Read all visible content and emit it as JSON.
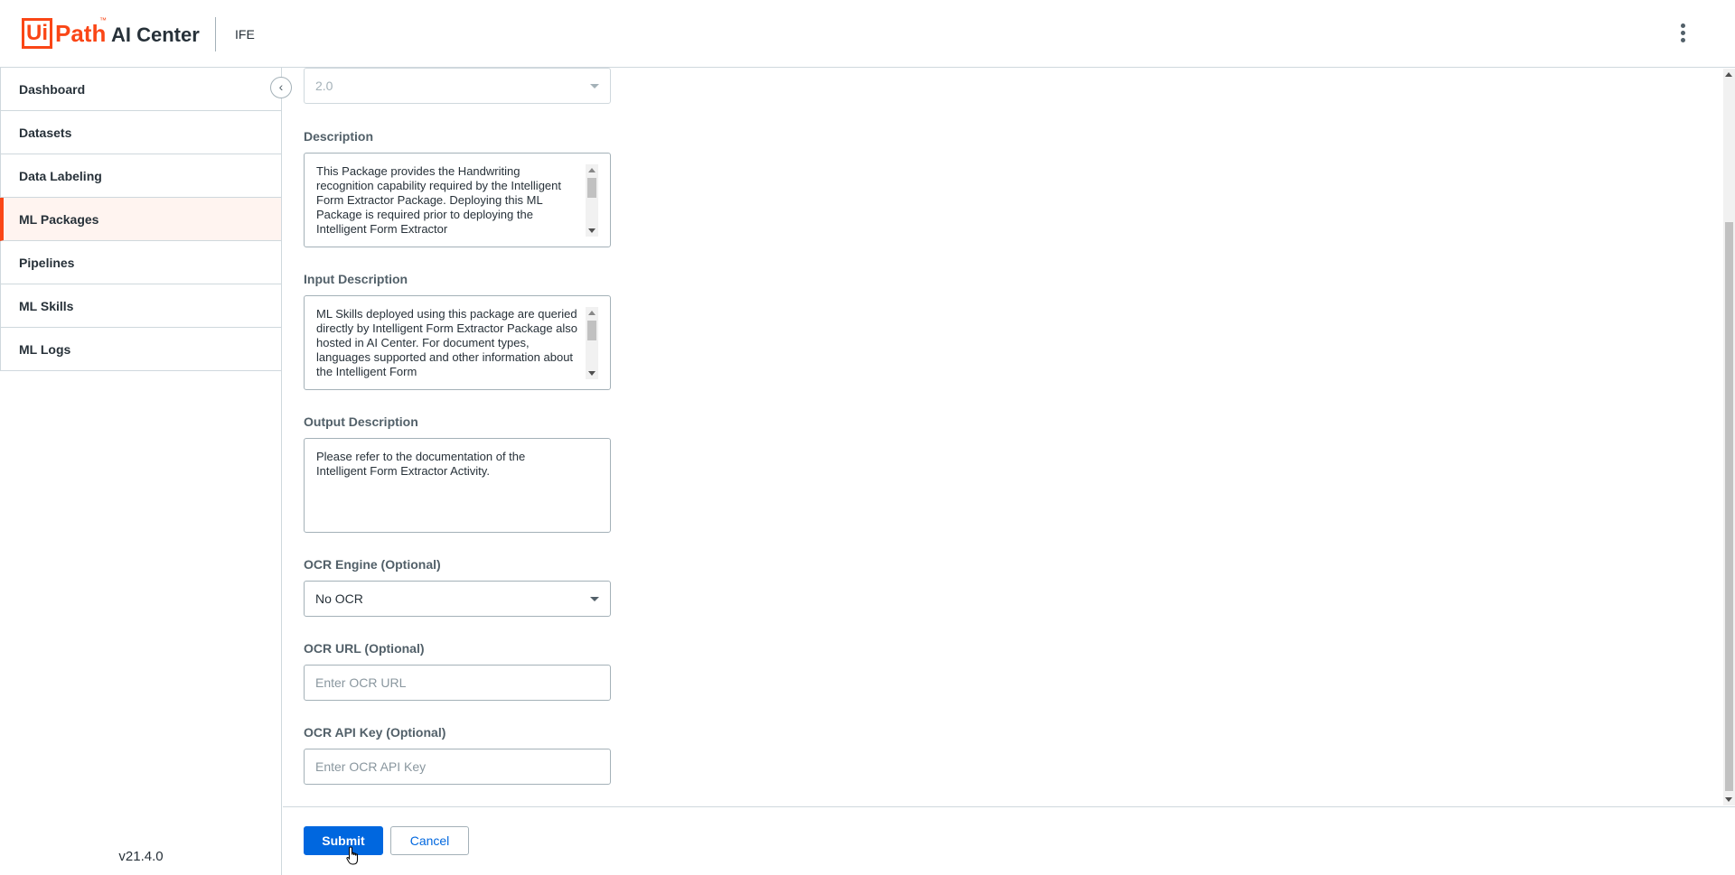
{
  "header": {
    "logo_ui": "Ui",
    "logo_path": "Path",
    "logo_tm": "™",
    "product": "AI Center",
    "tenant": "IFE"
  },
  "sidebar": {
    "items": [
      {
        "label": "Dashboard",
        "active": false
      },
      {
        "label": "Datasets",
        "active": false
      },
      {
        "label": "Data Labeling",
        "active": false
      },
      {
        "label": "ML Packages",
        "active": true
      },
      {
        "label": "Pipelines",
        "active": false
      },
      {
        "label": "ML Skills",
        "active": false
      },
      {
        "label": "ML Logs",
        "active": false
      }
    ],
    "version": "v21.4.0"
  },
  "form": {
    "version_select": {
      "value": "2.0"
    },
    "description": {
      "label": "Description",
      "value": "This Package provides the Handwriting recognition capability required by the Intelligent Form Extractor Package. Deploying this ML Package is required prior to deploying the Intelligent Form Extractor"
    },
    "input_description": {
      "label": "Input Description",
      "value": "ML Skills deployed using this package are queried directly by Intelligent Form Extractor Package also hosted in AI Center. For document types, languages supported and other information about the Intelligent Form"
    },
    "output_description": {
      "label": "Output Description",
      "value": "Please refer to the documentation of the Intelligent Form Extractor Activity."
    },
    "ocr_engine": {
      "label": "OCR Engine (Optional)",
      "value": "No OCR"
    },
    "ocr_url": {
      "label": "OCR URL (Optional)",
      "placeholder": "Enter OCR URL"
    },
    "ocr_api_key": {
      "label": "OCR API Key (Optional)",
      "placeholder": "Enter OCR API Key"
    }
  },
  "footer": {
    "submit_label": "Submit",
    "cancel_label": "Cancel"
  },
  "colors": {
    "brand": "#fa4616",
    "primary": "#0067df"
  }
}
